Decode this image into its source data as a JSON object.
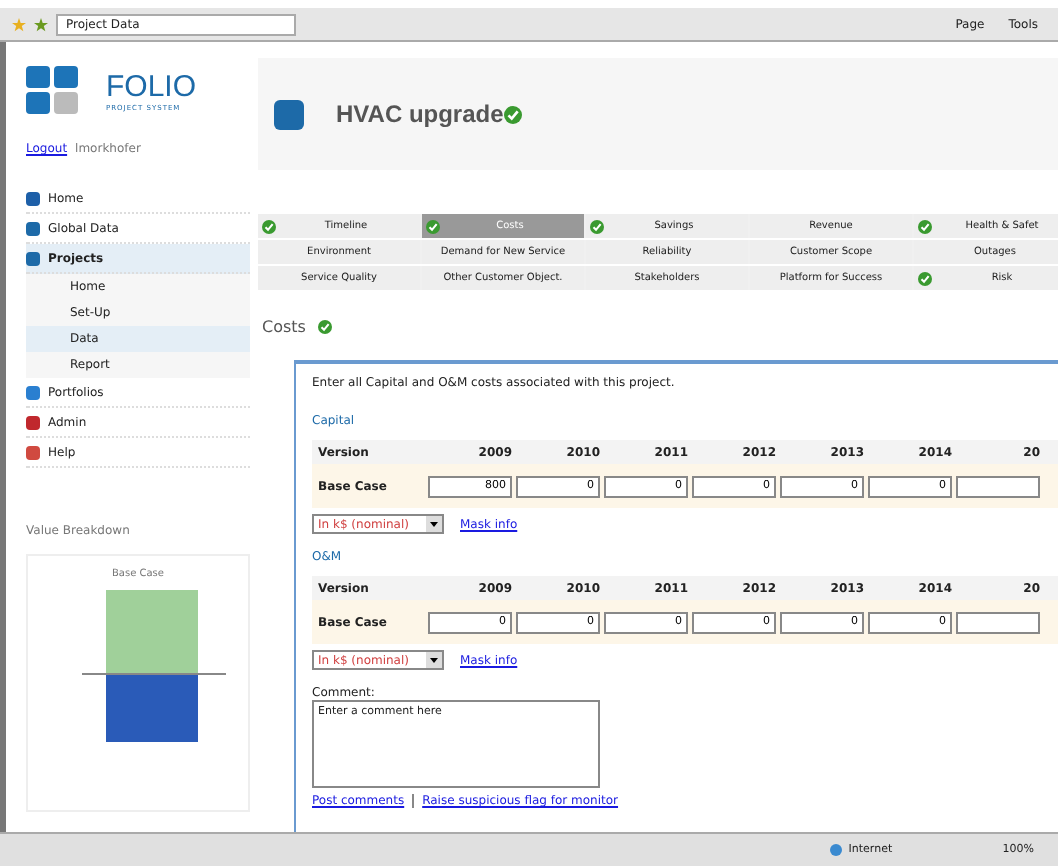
{
  "browser": {
    "tab_title": "Project Data",
    "toolbar": [
      "Page",
      "Tools"
    ]
  },
  "logo": {
    "name": "FOLIO",
    "tagline": "PROJECT SYSTEM"
  },
  "user": {
    "logout": "Logout",
    "username": "lmorkhofer"
  },
  "nav": [
    {
      "label": "Home",
      "selected": false
    },
    {
      "label": "Global Data",
      "selected": false
    },
    {
      "label": "Projects",
      "selected": true,
      "children": [
        {
          "label": "Home",
          "selected": false
        },
        {
          "label": "Set-Up",
          "selected": false
        },
        {
          "label": "Data",
          "selected": true
        },
        {
          "label": "Report",
          "selected": false
        }
      ]
    },
    {
      "label": "Portfolios",
      "selected": false
    },
    {
      "label": "Admin",
      "selected": false
    },
    {
      "label": "Help",
      "selected": false
    }
  ],
  "value_breakdown": {
    "title": "Value Breakdown",
    "chart_title": "Base Case"
  },
  "project": {
    "title": "HVAC upgrade",
    "complete": true
  },
  "tabs": [
    [
      {
        "label": "Timeline",
        "complete": true,
        "selected": false
      },
      {
        "label": "Costs",
        "complete": true,
        "selected": true
      },
      {
        "label": "Savings",
        "complete": true,
        "selected": false
      },
      {
        "label": "Revenue",
        "complete": false,
        "selected": false
      },
      {
        "label": "Health & Safet",
        "complete": true,
        "selected": false
      }
    ],
    [
      {
        "label": "Environment",
        "complete": false,
        "selected": false
      },
      {
        "label": "Demand for New Service",
        "complete": false,
        "selected": false
      },
      {
        "label": "Reliability",
        "complete": false,
        "selected": false
      },
      {
        "label": "Customer Scope",
        "complete": false,
        "selected": false
      },
      {
        "label": "Outages",
        "complete": false,
        "selected": false
      }
    ],
    [
      {
        "label": "Service Quality",
        "complete": false,
        "selected": false
      },
      {
        "label": "Other Customer Object.",
        "complete": false,
        "selected": false
      },
      {
        "label": "Stakeholders",
        "complete": false,
        "selected": false
      },
      {
        "label": "Platform for Success",
        "complete": false,
        "selected": false
      },
      {
        "label": "Risk",
        "complete": true,
        "selected": false
      }
    ]
  ],
  "section": {
    "title": "Costs",
    "complete": true,
    "intro": "Enter all Capital and O&M costs associated with this project.",
    "tables": [
      {
        "title": "Capital",
        "version_header": "Version",
        "years": [
          "2009",
          "2010",
          "2011",
          "2012",
          "2013",
          "2014",
          "20"
        ],
        "row_label": "Base Case",
        "values": [
          "800",
          "0",
          "0",
          "0",
          "0",
          "0"
        ],
        "unit": "In k$ (nominal)",
        "link": "Mask info"
      },
      {
        "title": "O&M",
        "version_header": "Version",
        "years": [
          "2009",
          "2010",
          "2011",
          "2012",
          "2013",
          "2014",
          "20"
        ],
        "row_label": "Base Case",
        "values": [
          "0",
          "0",
          "0",
          "0",
          "0",
          "0"
        ],
        "unit": "In k$ (nominal)",
        "link": "Mask info"
      }
    ],
    "comment_label": "Comment:",
    "comment_placeholder": "Enter a comment here",
    "links": [
      "Post comments",
      "Raise suspicious flag for monitor"
    ]
  },
  "status_bar": {
    "zone": "Internet",
    "zoom": "100%"
  }
}
